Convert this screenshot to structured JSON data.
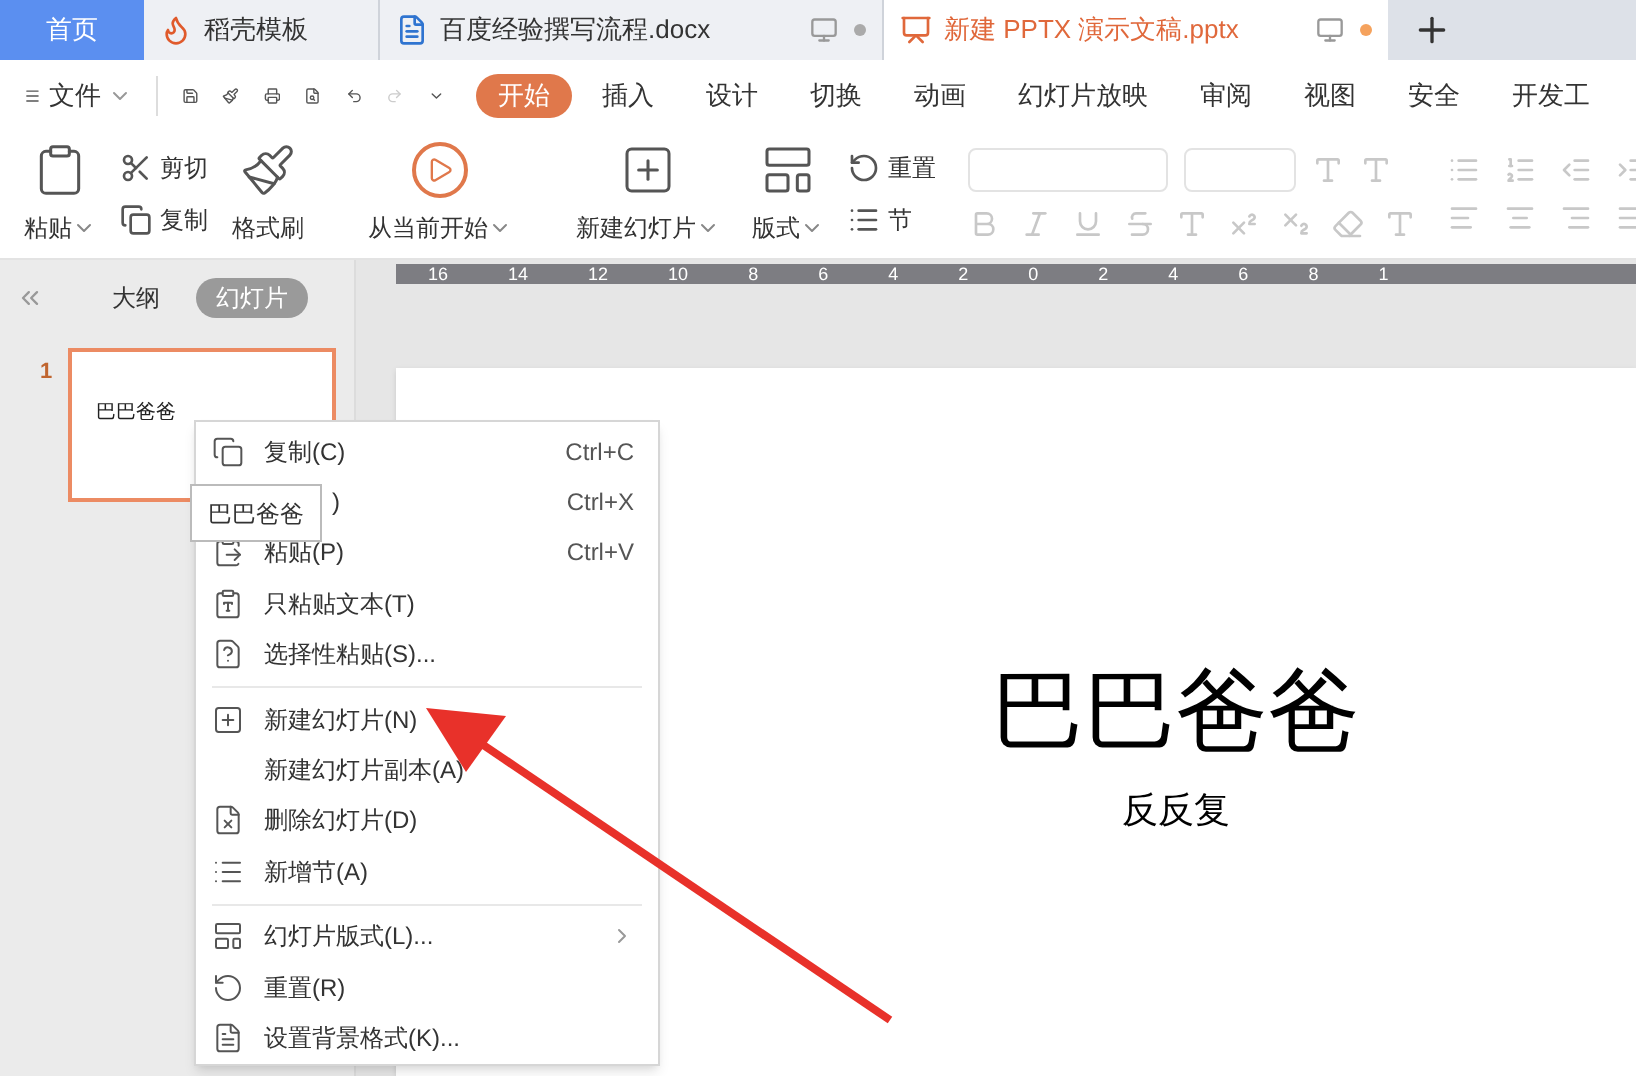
{
  "tabs": [
    {
      "kind": "home",
      "label": "首页",
      "selected": false
    },
    {
      "kind": "docer",
      "label": "稻壳模板",
      "selected": false
    },
    {
      "kind": "word",
      "label": "百度经验撰写流程.docx",
      "selected": false
    },
    {
      "kind": "ppt",
      "label": "新建 PPTX 演示文稿.pptx",
      "selected": true
    }
  ],
  "file_menu": "文件",
  "ribbon_tabs": [
    {
      "label": "开始",
      "selected": true
    },
    {
      "label": "插入",
      "selected": false
    },
    {
      "label": "设计",
      "selected": false
    },
    {
      "label": "切换",
      "selected": false
    },
    {
      "label": "动画",
      "selected": false
    },
    {
      "label": "幻灯片放映",
      "selected": false
    },
    {
      "label": "审阅",
      "selected": false
    },
    {
      "label": "视图",
      "selected": false
    },
    {
      "label": "安全",
      "selected": false
    },
    {
      "label": "开发工",
      "selected": false
    }
  ],
  "ribbon": {
    "paste": "粘贴",
    "cut": "剪切",
    "copy": "复制",
    "format_painter": "格式刷",
    "play_from_current": "从当前开始",
    "new_slide": "新建幻灯片",
    "layout": "版式",
    "reset": "重置",
    "section": "节"
  },
  "panel": {
    "tabs": [
      {
        "label": "大纲",
        "selected": false
      },
      {
        "label": "幻灯片",
        "selected": true
      }
    ],
    "slides": [
      {
        "number": "1",
        "title": "巴巴爸爸",
        "selected": true
      }
    ]
  },
  "ruler": [
    "16",
    "14",
    "12",
    "10",
    "8",
    "6",
    "4",
    "2",
    "0",
    "2",
    "4",
    "6",
    "8",
    "1"
  ],
  "slide": {
    "title": "巴巴爸爸",
    "subtitle": "反反复"
  },
  "tooltip": "巴巴爸爸",
  "context_menu": [
    {
      "kind": "item",
      "label": "复制(C)",
      "shortcut": "Ctrl+C"
    },
    {
      "kind": "covered",
      "label": ")",
      "shortcut": "Ctrl+X"
    },
    {
      "kind": "item",
      "label": "粘贴(P)",
      "shortcut": "Ctrl+V"
    },
    {
      "kind": "item",
      "label": "只粘贴文本(T)"
    },
    {
      "kind": "item",
      "label": "选择性粘贴(S)..."
    },
    {
      "kind": "separator"
    },
    {
      "kind": "item",
      "label": "新建幻灯片(N)"
    },
    {
      "kind": "item",
      "label": "新建幻灯片副本(A)"
    },
    {
      "kind": "item",
      "label": "删除幻灯片(D)"
    },
    {
      "kind": "item",
      "label": "新增节(A)"
    },
    {
      "kind": "separator"
    },
    {
      "kind": "submenu",
      "label": "幻灯片版式(L)..."
    },
    {
      "kind": "item",
      "label": "重置(R)"
    },
    {
      "kind": "item",
      "label": "设置背景格式(K)..."
    }
  ]
}
